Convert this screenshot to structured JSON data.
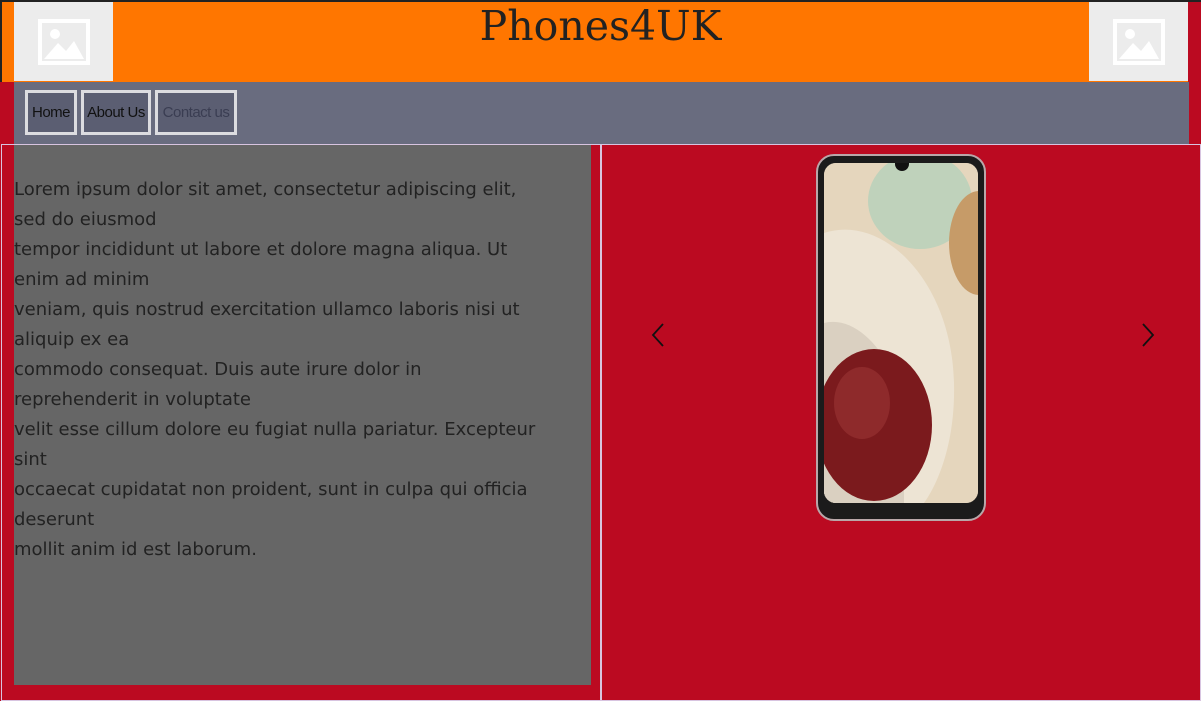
{
  "header": {
    "title": "Phones4UK",
    "left_image_icon": "image-placeholder-icon",
    "right_image_icon": "image-placeholder-icon"
  },
  "nav": {
    "items": [
      {
        "label": "Home"
      },
      {
        "label": "About Us"
      },
      {
        "label": "Contact us"
      }
    ]
  },
  "main": {
    "paragraph": "Lorem ipsum dolor sit amet, consectetur adipiscing elit,\nsed do eiusmod\ntempor incididunt ut labore et dolore magna aliqua. Ut\nenim ad minim\nveniam, quis nostrud exercitation ullamco laboris nisi ut\naliquip ex ea\ncommodo consequat. Duis aute irure dolor in\nreprehenderit in voluptate\nvelit esse cillum dolore eu fugiat nulla pariatur. Excepteur\nsint\noccaecat cupidatat non proident, sunt in culpa qui officia\ndeserunt\nmollit anim id est laborum."
  },
  "carousel": {
    "prev_icon": "chevron-left-icon",
    "next_icon": "chevron-right-icon",
    "image": "phone-image"
  },
  "colors": {
    "header_bg": "#ff7600",
    "page_bg": "#bb0a21",
    "nav_bg": "#696c7f",
    "text_panel_bg": "#666666"
  }
}
